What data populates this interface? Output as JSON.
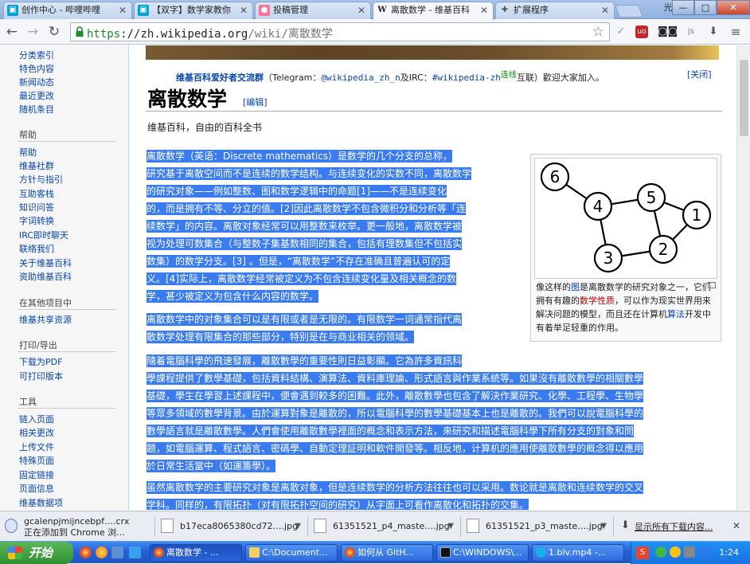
{
  "browser": {
    "tabs": [
      {
        "label": "创作中心 - 哔哩哔哩",
        "icon": "bilibili-icon",
        "color": "#00a1d6"
      },
      {
        "label": "【双字】数学家教你",
        "icon": "bilibili-icon",
        "color": "#00a1d6"
      },
      {
        "label": "投稿管理",
        "icon": "bilibili-tv-icon",
        "color": "#fb7299"
      },
      {
        "label": "离散数学 - 维基百科",
        "icon": "wikipedia-icon",
        "color": "#222222"
      },
      {
        "label": "扩展程序",
        "icon": "puzzle-icon",
        "color": "#555555"
      }
    ],
    "user_button": "光",
    "window": {
      "minimize": "—",
      "maximize": "□",
      "close": "✕"
    },
    "url_scheme": "https",
    "url_rest": "://zh.wikipedia.org",
    "url_path": "/wiki/离散数学",
    "extensions": [
      "translate-icon",
      "adblock-icon",
      "glasses-icon",
      "js-icon",
      "download-arrow-icon",
      "menu-icon"
    ]
  },
  "sidebar": {
    "items_top": [
      "分类索引",
      "特色内容",
      "新闻动态",
      "最近更改",
      "随机条目"
    ],
    "help_heading": "帮助",
    "help_items": [
      "帮助",
      "维基社群",
      "方针与指引",
      "互助客栈",
      "知识问答",
      "字词转换",
      "IRC即时聊天",
      "联络我们",
      "关于维基百科",
      "资助维基百科"
    ],
    "other_heading": "在其他项目中",
    "other_items": [
      "维基共享资源"
    ],
    "print_heading": "打印/导出",
    "print_items": [
      "下载为PDF",
      "可打印版本"
    ],
    "tools_heading": "工具",
    "tools_items": [
      "链入页面",
      "相关更改",
      "上传文件",
      "特殊页面",
      "固定链接",
      "页面信息",
      "维基数据项"
    ]
  },
  "notice": {
    "bold": "维基百科爱好者交流群",
    "prefix": "（Telegram：",
    "tg": "@wikipedia_zh_n",
    "mid": "及IRC：",
    "irc": "#wikipedia-zh",
    "green": "连线",
    "suffix": "互联）歡迎大家加入。",
    "close": "[关闭]"
  },
  "article": {
    "title": "离散数学",
    "edit": "[编辑]",
    "tagline": "维基百科，自由的百科全书",
    "p1": [
      "离散数学（英语：Discrete mathematics）是数学的几个分支的总称，",
      "研究基于离散空间而不是连续的数学结构。与连续变化的实数不同，离散数学",
      "的研究对象——例如整数、图和数学逻辑中的命题[1]——不是连续变化",
      "的，而是拥有不等、分立的值。[2]因此离散数学不包含微积分和分析等「连",
      "续数学」的内容。离散对象经常可以用整数来枚举。更一般地，离散数学被",
      "视为处理可数集合（与整数子集基数相同的集合，包括有理数集但不包括实",
      "数集）的数学分支。[3] 。但是，“离散数学”不存在准确且普遍认可的定",
      "义。[4]实际上，离散数学经常被定义为不包含连续变化量及相关概念的数",
      "学，甚少被定义为包含什么内容的数学。"
    ],
    "p2": [
      "离散数学中的对象集合可以是有限或者是无限的。有限数学一词通常指代离",
      "散数学处理有限集合的那些部分，特别是在与商业相关的领域。"
    ],
    "p3": [
      "隨着電腦科學的飛速發展，離散數學的重要性則日益彰顯。它為許多資訊科",
      "學課程提供了數學基礎，包括資料結構、演算法、資料庫理論、形式語言與作業系統等。如果沒有離散數學的相關數學",
      "基礎，學生在學習上述課程中，便會遇到較多的困難。此外，離散數學也包含了解決作業研究、化學、工程學、生物學",
      "等眾多領域的數學背景。由於運算對象是離散的，所以電腦科學的數學基礎基本上也是離散的。我們可以說電腦科學的",
      "數學語言就是離散數學。人們會使用離散數學裡面的概念和表示方法，來研究和描述電腦科學下所有分支的對象和問",
      "題，如電腦運算、程式語言、密碼學、自動定理証明和軟件開發等。相反地，计算机的應用使離散數學的概念得以應用",
      "於日常生活當中（如運籌學）。"
    ],
    "p4": [
      "虽然离散数学的主要研究对象是离散对象，但是连续数学的分析方法往往也可以采用。数论就是离散和连续数学的交叉",
      "学科。同样的，有限拓扑（对有限拓扑空间的研究）从字面上可看作离散化和拓扑的交集。"
    ]
  },
  "infobox": {
    "nodes": [
      "6",
      "4",
      "5",
      "1",
      "3",
      "2"
    ],
    "caption_a": "像这样的",
    "caption_link1": "图",
    "caption_b": "是离散数学的研究对象之一，它们拥有有趣的",
    "caption_link2": "数学性质",
    "caption_c": "，可以作为现实世界用来解决问题的模型，而且还在计算机",
    "caption_link3": "算法",
    "caption_d": "开发中有着举足轻重的作用。"
  },
  "downloads": {
    "items": [
      {
        "name": "gcalenpjmijncebpf….crx",
        "status": "正在添加到 Chrome 浏…"
      },
      {
        "name": "b17eca8065380cd72….jpg",
        "status": ""
      },
      {
        "name": "61351521_p4_maste….jpg",
        "status": ""
      },
      {
        "name": "61351521_p3_maste….jpg",
        "status": ""
      }
    ],
    "show_all": "显示所有下载内容...",
    "close": "✕"
  },
  "taskbar": {
    "start": "开始",
    "buttons": [
      "离散数学 - ...",
      "C:\\Document...",
      "如何从 GitH...",
      "C:\\WINDOWS\\...",
      "1.blv.mp4 -..."
    ],
    "clock": "1:24"
  },
  "colors": {
    "highlight": "#3a7cf0",
    "link": "#0645ad",
    "red_link": "#ba0000",
    "taskbar": "#2660d8"
  }
}
